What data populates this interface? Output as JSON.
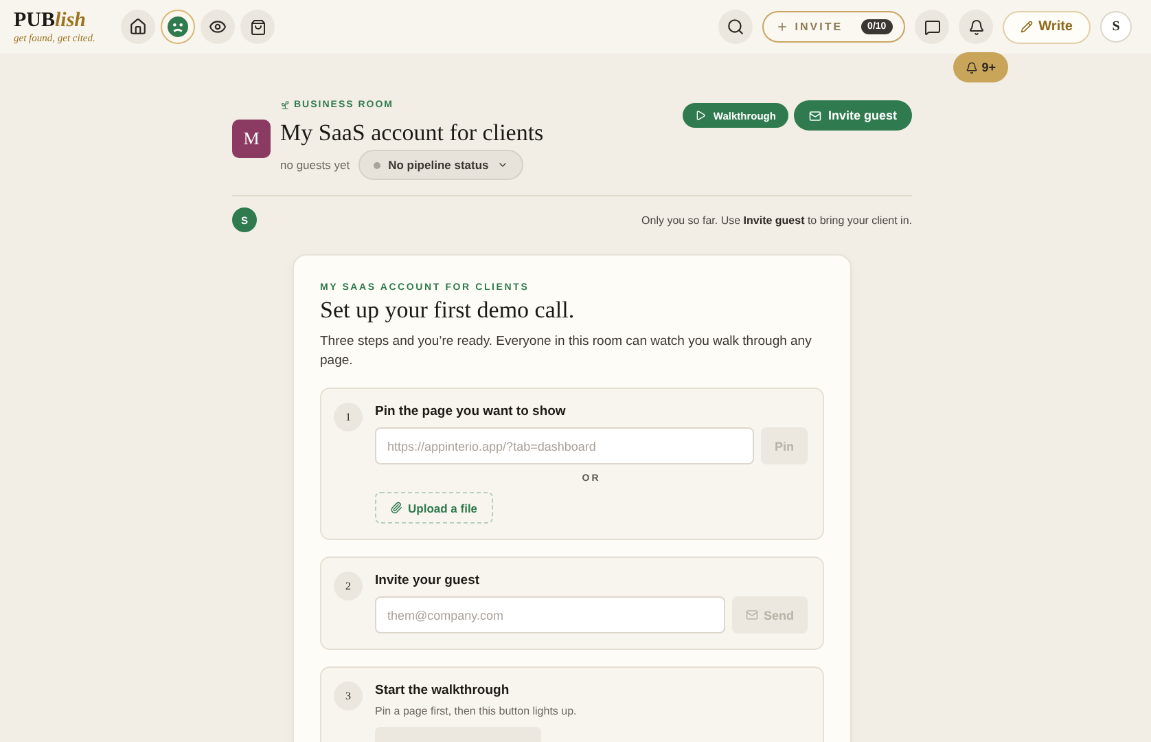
{
  "header": {
    "logo": {
      "brand": "PUB",
      "brand_accent": "lish",
      "tagline": "get found, get cited."
    },
    "nav": [
      {
        "kind": "home",
        "selected": false
      },
      {
        "kind": "room",
        "selected": true
      },
      {
        "kind": "watch",
        "selected": false
      },
      {
        "kind": "shop",
        "selected": false
      }
    ],
    "invite": {
      "label": "INVITE",
      "count": "0/10"
    },
    "notifications": {
      "badge": "9+"
    },
    "write": "Write",
    "avatar": "S"
  },
  "room": {
    "eyebrow": "BUSINESS ROOM",
    "avatar": "M",
    "title": "My SaaS account for clients",
    "guests": "no guests yet",
    "status": "No pipeline status",
    "actions": [
      {
        "kind": "walkthrough",
        "label": "Walkthrough"
      },
      {
        "kind": "invite",
        "label": "Invite guest"
      }
    ]
  },
  "members": {
    "avatar": "S",
    "note": "Only you so far. Use **Invite guest** to bring your client in."
  },
  "setup": {
    "eyebrow": "MY SAAS ACCOUNT FOR CLIENTS",
    "title": "Set up your first demo call.",
    "intro": "Three steps and you’re ready. Everyone in this room can watch you walk through any page.",
    "steps": [
      {
        "kind": "pin",
        "number": "1",
        "title": "Pin the page you want to show",
        "placeholder": "https://appinterio.app/?tab=dashboard",
        "button": "Pin",
        "disabled": true,
        "divider": "OR",
        "upload": "Upload a file"
      },
      {
        "kind": "invite",
        "number": "2",
        "title": "Invite your guest",
        "placeholder": "them@company.com",
        "button": "Send",
        "disabled": true
      },
      {
        "kind": "start",
        "number": "3",
        "title": "Start the walkthrough",
        "hint": "Pin a page first, then this button lights up.",
        "disabled": true
      }
    ]
  }
}
